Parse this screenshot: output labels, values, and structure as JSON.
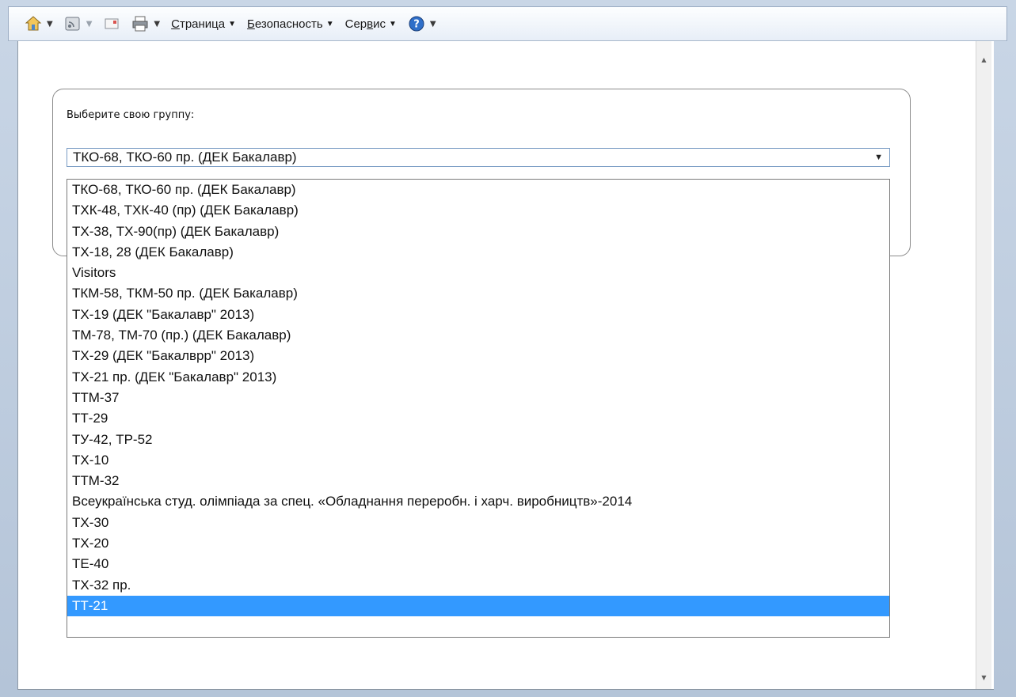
{
  "toolbar": {
    "icons": [
      "home-icon",
      "feeds-icon",
      "mail-icon",
      "print-icon",
      "help-icon"
    ],
    "menus": [
      {
        "id": "page",
        "accel": "С",
        "rest": "траница"
      },
      {
        "id": "safety",
        "accel": "Б",
        "rest": "езопасность"
      },
      {
        "id": "tools",
        "pre": "Сер",
        "accel": "в",
        "rest": "ис"
      }
    ]
  },
  "form": {
    "prompt": "Выберите свою группу:",
    "selected_value": "ТКО-68, ТКО-60 пр. (ДЕК Бакалавр)",
    "options": [
      "ТКО-68, ТКО-60 пр. (ДЕК Бакалавр)",
      "ТХК-48, ТХК-40 (пр) (ДЕК Бакалавр)",
      "ТХ-38, ТХ-90(пр) (ДЕК Бакалавр)",
      "ТХ-18, 28 (ДЕК Бакалавр)",
      "Visitors",
      "ТКМ-58, ТКМ-50 пр. (ДЕК Бакалавр)",
      "ТХ-19 (ДЕК \"Бакалавр\" 2013)",
      "ТМ-78, ТМ-70 (пр.) (ДЕК Бакалавр)",
      "ТХ-29 (ДЕК \"Бакалврр\" 2013)",
      "ТХ-21 пр. (ДЕК \"Бакалавр\" 2013)",
      "ТТМ-37",
      "ТТ-29",
      "ТУ-42, ТР-52",
      "ТХ-10",
      "ТТМ-32",
      "Всеукраїнська студ. олімпіада за спец. «Обладнання переробн. і харч. виробництв»-2014",
      "ТХ-30",
      "ТХ-20",
      "ТЕ-40",
      "ТХ-32 пр.",
      "ТТ-21"
    ],
    "highlighted_index": 20
  },
  "colors": {
    "highlight": "#3399ff",
    "select_border": "#7a9cc4"
  }
}
